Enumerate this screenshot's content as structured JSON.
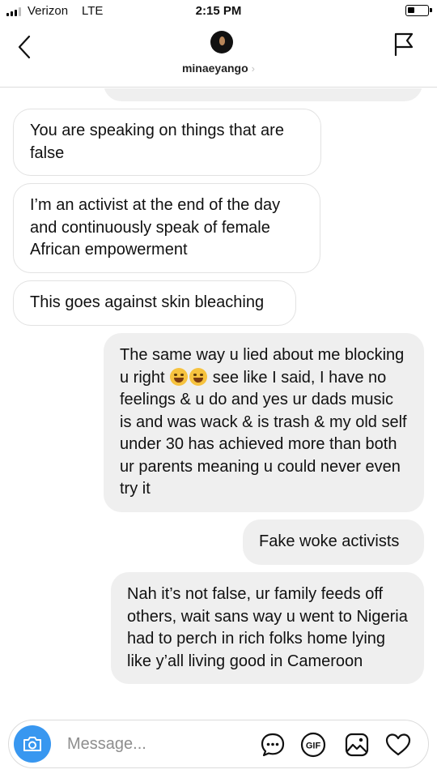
{
  "status_bar": {
    "carrier": "Verizon",
    "network": "LTE",
    "time": "2:15 PM",
    "battery_level": 0.35
  },
  "header": {
    "username": "minaeyango",
    "chevron": "›",
    "icons": {
      "back": "chevron-left-icon",
      "flag": "flag-icon"
    }
  },
  "messages": [
    {
      "direction": "incoming",
      "text": "You are speaking on things that are false"
    },
    {
      "direction": "incoming",
      "text": "I’m an activist at the end of the day and continuously speak of female African empowerment"
    },
    {
      "direction": "incoming",
      "text": "This goes against skin bleaching"
    },
    {
      "direction": "outgoing",
      "text_before_emoji": "The same way u lied about me blocking u right",
      "emojis": [
        "rolling-on-floor-laughing-emoji",
        "tears-of-joy-emoji"
      ],
      "text_after_emoji": "see like I said, I have no feelings & u do and yes ur dads music is and was wack & is trash & my old self under 30 has achieved more than both ur parents meaning u could never even try it"
    },
    {
      "direction": "outgoing",
      "text": "Fake woke activists"
    },
    {
      "direction": "outgoing",
      "text": "Nah it’s not false, ur family feeds off others, wait sans way u went to Nigeria had to perch in rich folks home lying like y’all living good in Cameroon"
    }
  ],
  "composer": {
    "placeholder": "Message...",
    "gif_label": "GIF",
    "icons": {
      "camera": "camera-icon",
      "sticker": "sticker-chat-icon",
      "gif": "gif-icon",
      "gallery": "gallery-icon",
      "like": "heart-icon"
    }
  },
  "colors": {
    "accent": "#3897f0",
    "outgoing_bubble": "#efefef",
    "incoming_border": "#e2e2e2",
    "placeholder": "#8e8e8e"
  }
}
